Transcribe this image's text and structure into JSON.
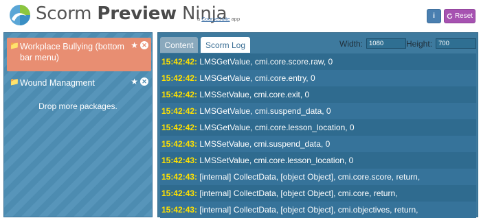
{
  "app": {
    "title_part1": "Scorm ",
    "title_part2": "Preview",
    "title_part3": " Ninja",
    "byline_prefix": "a ",
    "byline_link": "CourseSuite",
    "byline_suffix": " app"
  },
  "header": {
    "reset_label": "Reset"
  },
  "sidebar": {
    "packages": [
      {
        "label": "Workplace Bullying (bottom bar menu)"
      },
      {
        "label": "Wound Managment"
      }
    ],
    "drop_text": "Drop more packages."
  },
  "tabs": [
    {
      "label": "Content"
    },
    {
      "label": "Scorm Log"
    }
  ],
  "dimensions": {
    "width_label": "Width:",
    "width_value": "1080",
    "height_label": "Height:",
    "height_value": "700"
  },
  "log": [
    {
      "time": "15:42:42:",
      "text": " LMSGetValue, cmi.core.score.raw, 0"
    },
    {
      "time": "15:42:42:",
      "text": " LMSGetValue, cmi.core.entry, 0"
    },
    {
      "time": "15:42:42:",
      "text": " LMSSetValue, cmi.core.exit, 0"
    },
    {
      "time": "15:42:42:",
      "text": " LMSGetValue, cmi.suspend_data, 0"
    },
    {
      "time": "15:42:42:",
      "text": " LMSGetValue, cmi.core.lesson_location, 0"
    },
    {
      "time": "15:42:43:",
      "text": " LMSSetValue, cmi.suspend_data, 0"
    },
    {
      "time": "15:42:43:",
      "text": " LMSSetValue, cmi.core.lesson_location, 0"
    },
    {
      "time": "15:42:43:",
      "text": " [internal] CollectData, [object Object], cmi.core.score, return,"
    },
    {
      "time": "15:42:43:",
      "text": " [internal] CollectData, [object Object], cmi.core, return,"
    },
    {
      "time": "15:42:43:",
      "text": " [internal] CollectData, [object Object], cmi.objectives, return,"
    }
  ],
  "colors": {
    "accent_orange": "#e88e72",
    "reset_purple": "#a652b1",
    "info_blue": "#4a7fb0",
    "timestamp_yellow": "#ffe100"
  },
  "icons": {
    "logo": "scorm-logo-icon",
    "info": "info-icon",
    "reset": "refresh-icon",
    "folder": "folder-icon",
    "star": "star-icon",
    "remove": "close-circle-icon"
  }
}
